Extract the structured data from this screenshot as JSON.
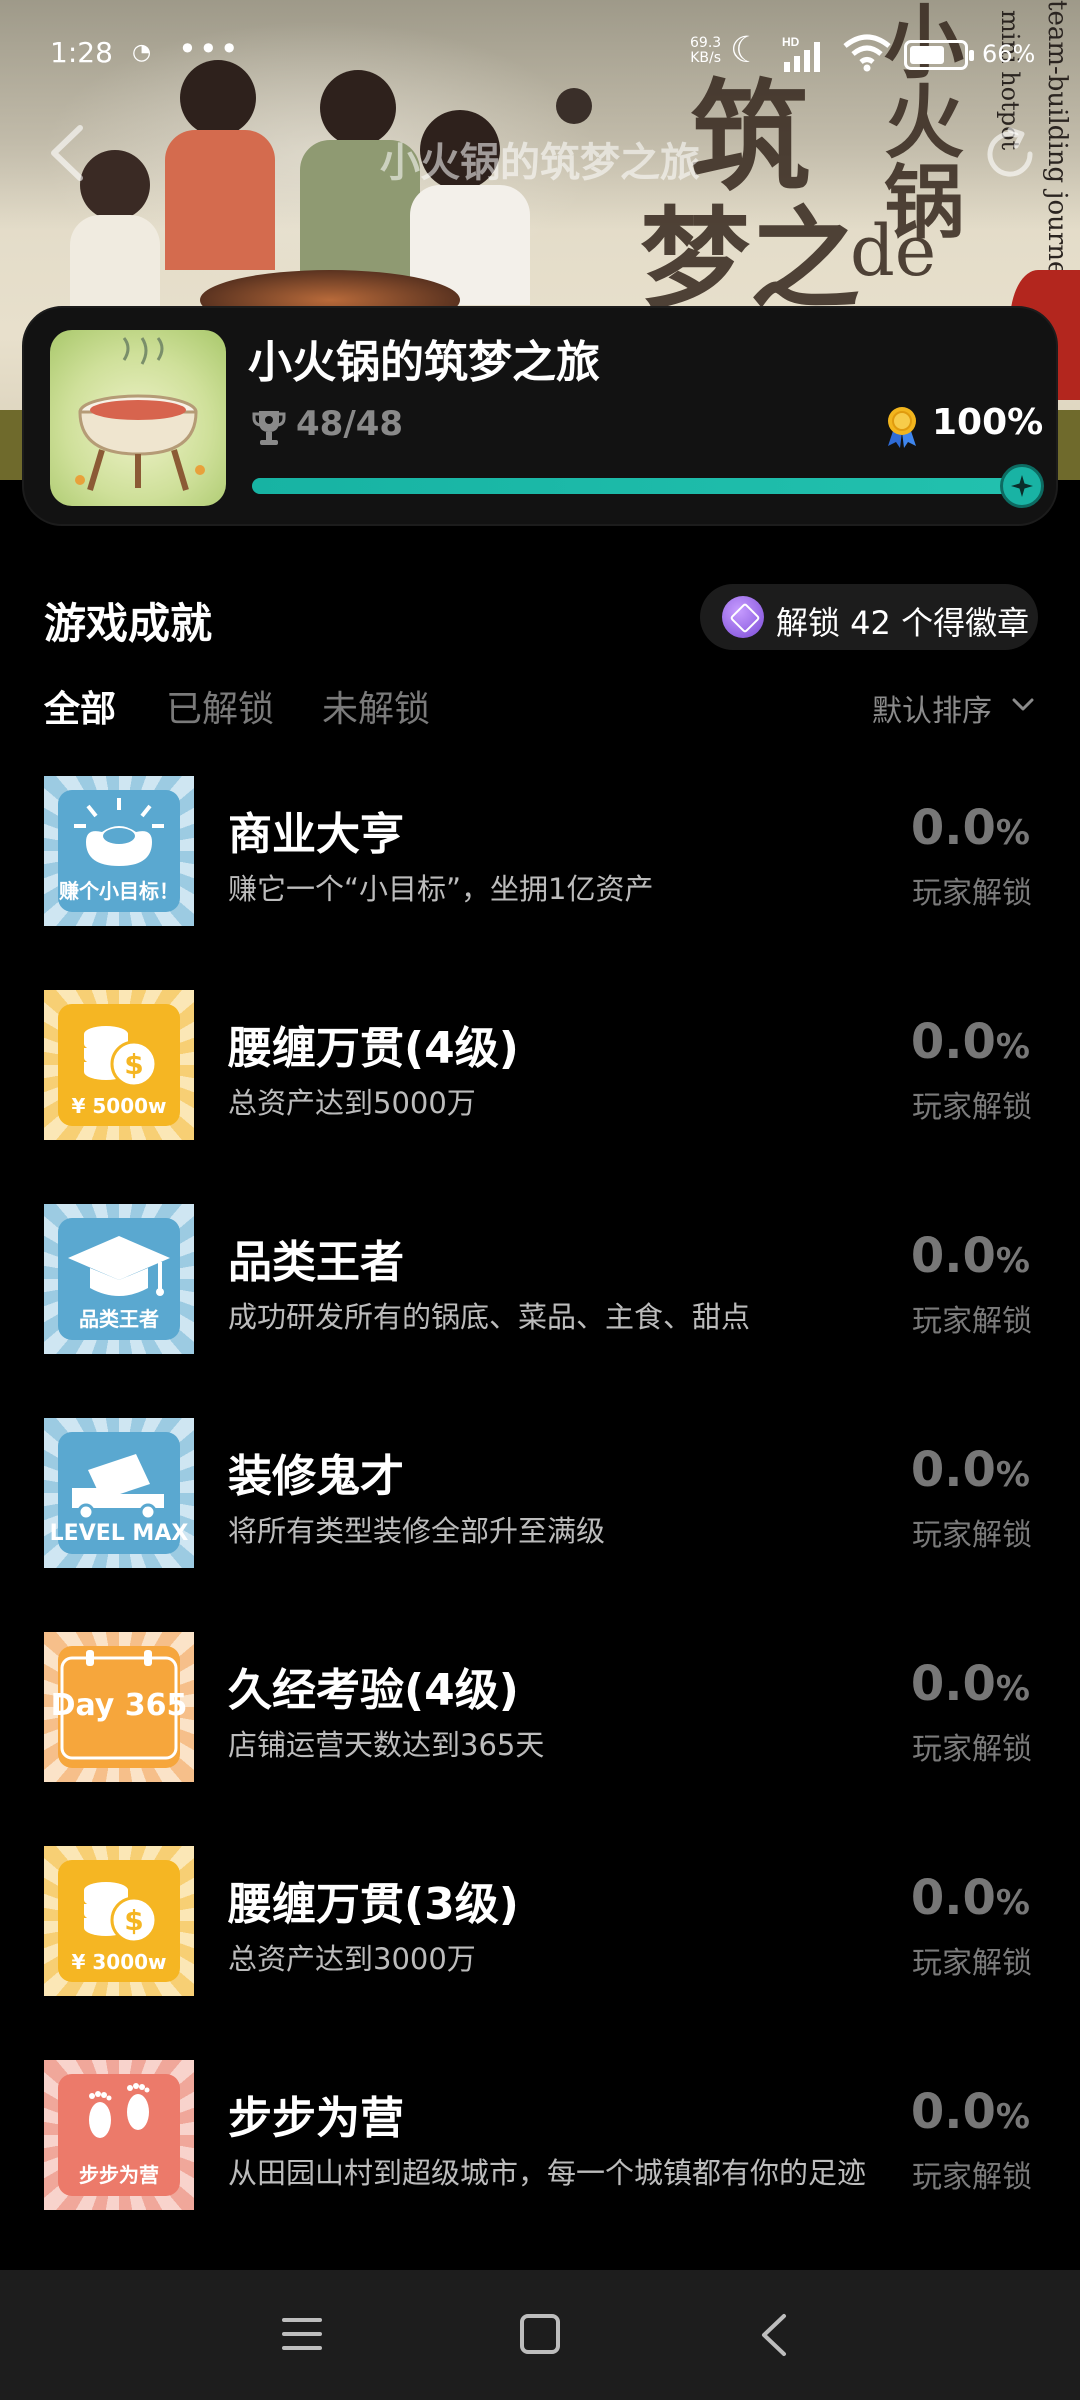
{
  "status_bar": {
    "time": "1:28",
    "network_speed_value": "69.3",
    "network_speed_unit": "KB/s",
    "signal_label": "HD",
    "battery_percent": "66%",
    "battery_level": 0.66
  },
  "nav": {
    "title": "小火锅的筑梦之旅"
  },
  "banner": {
    "calligraphy_1": "筑",
    "calligraphy_2": "梦之",
    "calligraphy_3": "小火锅",
    "calligraphy_4": "de",
    "vertical_en_1": "team-building journey",
    "vertical_en_2": "mini hotpot"
  },
  "game_card": {
    "name": "小火锅的筑梦之旅",
    "trophy_count": "48/48",
    "completion_percent": "100%",
    "progress": 1.0
  },
  "section": {
    "title": "游戏成就",
    "badge_text": "解锁 42 个得徽章"
  },
  "tabs": [
    {
      "label": "全部",
      "active": true
    },
    {
      "label": "已解锁",
      "active": false
    },
    {
      "label": "未解锁",
      "active": false
    }
  ],
  "sort": {
    "label": "默认排序"
  },
  "achievements": [
    {
      "title": "商业大亨",
      "desc": "赚它一个“小目标”，坐拥1亿资产",
      "percent": "0.0",
      "unit": "%",
      "unlock_label": "玩家解锁",
      "icon_caption": "赚个小目标！",
      "icon": "gold-ingot-icon",
      "theme": "blue"
    },
    {
      "title": "腰缠万贯(4级)",
      "desc": "总资产达到5000万",
      "percent": "0.0",
      "unit": "%",
      "unlock_label": "玩家解锁",
      "icon_caption": "¥ 5000w",
      "icon": "coin-stack-icon",
      "theme": "yellow"
    },
    {
      "title": "品类王者",
      "desc": "成功研发所有的锅底、菜品、主食、甜点",
      "percent": "0.0",
      "unit": "%",
      "unlock_label": "玩家解锁",
      "icon_caption": "品类王者",
      "icon": "graduation-cap-icon",
      "theme": "blue"
    },
    {
      "title": "装修鬼才",
      "desc": "将所有类型装修全部升至满级",
      "percent": "0.0",
      "unit": "%",
      "unlock_label": "玩家解锁",
      "icon_caption": "LEVEL MAX",
      "icon": "cement-truck-icon",
      "theme": "blue"
    },
    {
      "title": "久经考验(4级)",
      "desc": "店铺运营天数达到365天",
      "percent": "0.0",
      "unit": "%",
      "unlock_label": "玩家解锁",
      "icon_caption": "Day 365",
      "icon": "calendar-icon",
      "theme": "orange"
    },
    {
      "title": "腰缠万贯(3级)",
      "desc": "总资产达到3000万",
      "percent": "0.0",
      "unit": "%",
      "unlock_label": "玩家解锁",
      "icon_caption": "¥ 3000w",
      "icon": "coin-stack-icon",
      "theme": "yellow"
    },
    {
      "title": "步步为营",
      "desc": "从田园山村到超级城市，每一个城镇都有你的足迹",
      "percent": "0.0",
      "unit": "%",
      "unlock_label": "玩家解锁",
      "icon_caption": "步步为营",
      "icon": "footprints-icon",
      "theme": "red"
    }
  ],
  "colors": {
    "accent_teal": "#19b3a4",
    "background": "#000000",
    "card": "#121212"
  }
}
